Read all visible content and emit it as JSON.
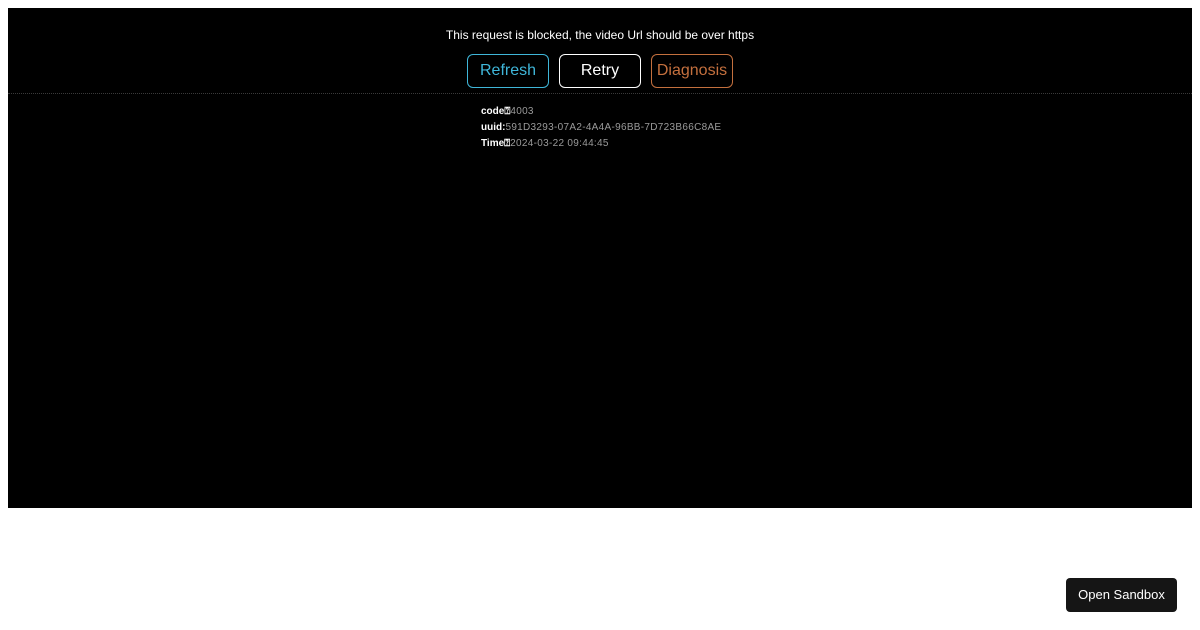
{
  "player": {
    "error_message": "This request is blocked, the video Url should be over https",
    "buttons": {
      "refresh_label": "Refresh",
      "retry_label": "Retry",
      "diagnosis_label": "Diagnosis"
    },
    "details": {
      "code_label": "code",
      "code_sep": "⍰",
      "code_value": "4003",
      "uuid_label": "uuid",
      "uuid_sep": ":",
      "uuid_value": "591D3293-07A2-4A4A-96BB-7D723B66C8AE",
      "time_label": "Time",
      "time_sep": "⍰",
      "time_value": "2024-03-22 09:44:45"
    }
  },
  "sandbox": {
    "button_label": "Open Sandbox"
  },
  "colors": {
    "refresh": "#3fb6d9",
    "retry": "#ffffff",
    "diagnosis": "#c4703e",
    "player_background": "#000000"
  }
}
